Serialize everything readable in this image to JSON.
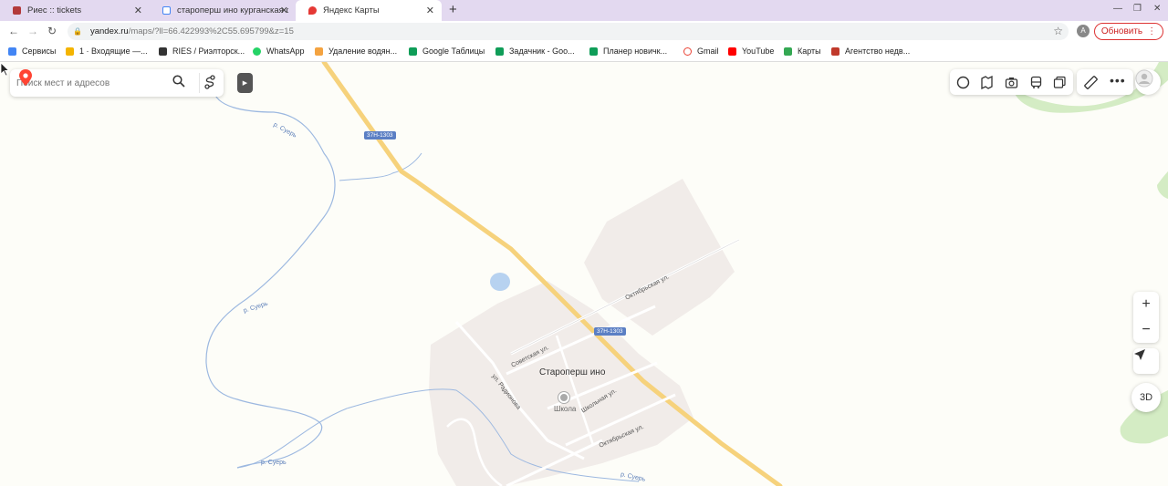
{
  "tabs": [
    {
      "title": "Риес :: tickets",
      "favicon_color": "#b33a3a"
    },
    {
      "title": "староперш ино курганская о",
      "favicon_color": "#4285f4"
    },
    {
      "title": "Яндекс Карты",
      "favicon_color": "#e53935"
    }
  ],
  "address_bar": {
    "domain": "yandex.ru",
    "path": "/maps/?ll=66.422993%2C55.695799&z=15"
  },
  "profile_letter": "A",
  "update_button": "Обновить",
  "bookmarks": [
    {
      "label": "Сервисы",
      "icon_color": "#4285f4"
    },
    {
      "label": "1 · Входящие —...",
      "icon_color": "#f4b400"
    },
    {
      "label": "RIES / Риэлторск...",
      "icon_color": "#333333"
    },
    {
      "label": "WhatsApp",
      "icon_color": "#25d366"
    },
    {
      "label": "Удаление водян...",
      "icon_color": "#f4a340"
    },
    {
      "label": "Google Таблицы",
      "icon_color": "#0f9d58"
    },
    {
      "label": "Задачник - Goo...",
      "icon_color": "#0f9d58"
    },
    {
      "label": "Планер новичк...",
      "icon_color": "#0f9d58"
    },
    {
      "label": "Gmail",
      "icon_color": "#ea4335"
    },
    {
      "label": "YouTube",
      "icon_color": "#ff0000"
    },
    {
      "label": "Карты",
      "icon_color": "#34a853"
    },
    {
      "label": "Агентство недв...",
      "icon_color": "#c0392b"
    }
  ],
  "search": {
    "placeholder": "Поиск мест и адресов"
  },
  "map": {
    "village": "Староперш ино",
    "school": "Школа",
    "road_shield_1": "37Н-1303",
    "road_shield_2": "37Н-1303",
    "streets": {
      "oktyabrskaya_1": "Октябрьская ул.",
      "sovetskaya": "Советская ул.",
      "radionova": "ул. Радионова",
      "shkolnaya": "Школьная ул.",
      "oktyabrskaya_2": "Октябрьская ул."
    },
    "rivers": {
      "r1": "р. Суерь",
      "r2": "р. Суерь",
      "r3": "р. Суерь",
      "r4": "р. Суерь"
    }
  },
  "controls": {
    "zoom_in": "+",
    "zoom_out": "−",
    "three_d": "3D"
  }
}
